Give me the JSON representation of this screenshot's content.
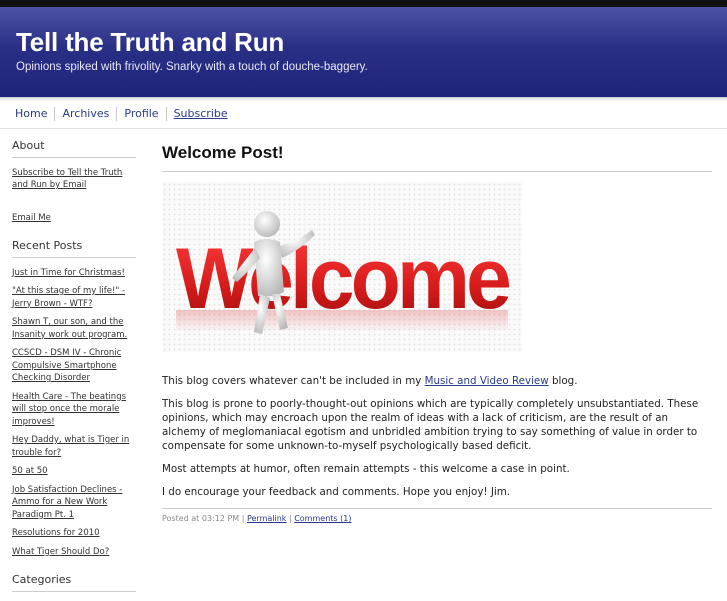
{
  "header": {
    "title": "Tell the Truth and Run",
    "description": "Opinions spiked with frivolity. Snarky with a touch of douche-baggery."
  },
  "nav": {
    "items": [
      "Home",
      "Archives",
      "Profile",
      "Subscribe"
    ]
  },
  "sidebar": {
    "about_heading": "About",
    "subscribe_link": "Subscribe to Tell the Truth and Run by Email",
    "email_link": "Email Me",
    "recent_heading": "Recent Posts",
    "recent_posts": [
      "Just in Time for Christmas!",
      "\"At this stage of my life!\" - Jerry Brown - WTF?",
      "Shawn T, our son, and the Insanity work out program.",
      "CCSCD - DSM IV - Chronic Compulsive Smartphone Checking Disorder",
      "Health Care - The beatings will stop once the morale improves!",
      "Hey Daddy, what is Tiger in trouble for?",
      "50 at 50",
      "Job Satisfaction Declines - Ammo for a New Work Paradigm Pt. 1",
      "Resolutions for 2010",
      "What Tiger Should Do?"
    ],
    "categories_heading": "Categories"
  },
  "post": {
    "title": "Welcome Post!",
    "image_word": "Welcome",
    "p1_before": "This blog covers whatever can't be included in my ",
    "p1_link": "Music and Video Review",
    "p1_after": " blog.",
    "p2": "This blog is prone to poorly-thought-out opinions which are typically completely unsubstantiated. These opinions, which may encroach upon the realm of ideas with a lack of criticism, are the result of an alchemy of meglomaniacal egotism and unbridled ambition trying to say something of value in order to compensate for some unknown-to-myself psychologically based deficit.",
    "p3": "Most attempts at humor, often remain attempts - this welcome a case in point.",
    "p4": "I do encourage your feedback and comments. Hope you enjoy! Jim.",
    "meta_posted": "Posted at 03:12 PM",
    "meta_sep": " | ",
    "meta_permalink": "Permalink",
    "meta_comments": "Comments (1)"
  },
  "colors": {
    "header_bg": "#2a2f86",
    "link": "#2a3a8a",
    "welcome_red": "#d42020"
  }
}
